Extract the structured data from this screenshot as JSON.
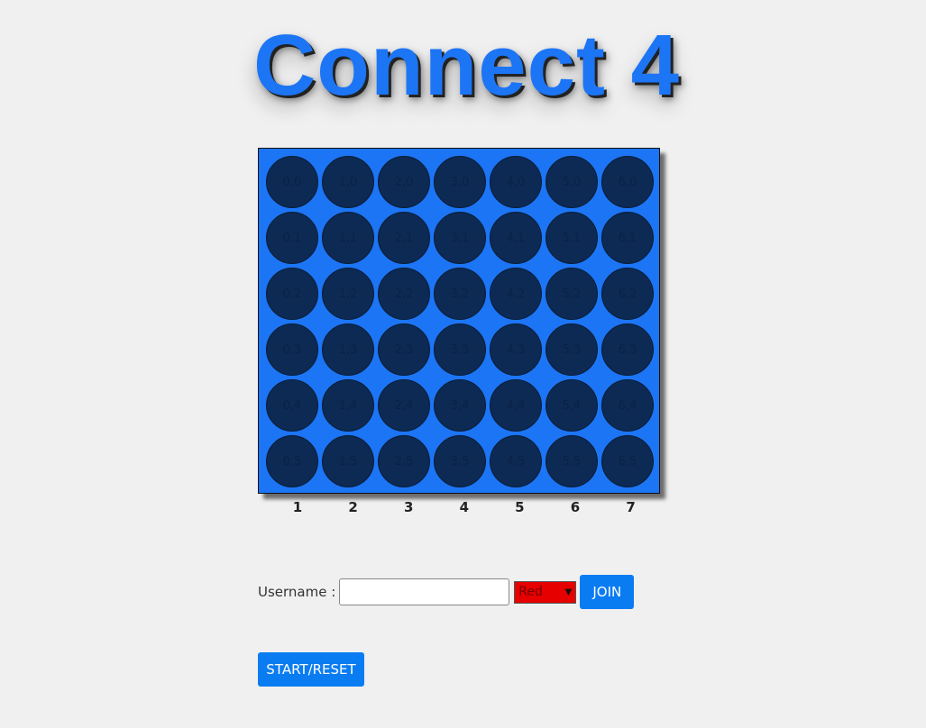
{
  "title": "Connect 4",
  "board": {
    "columns": 7,
    "rows": 6,
    "column_labels": [
      "1",
      "2",
      "3",
      "4",
      "5",
      "6",
      "7"
    ],
    "cells": [
      [
        "0,0",
        "1,0",
        "2,0",
        "3,0",
        "4,0",
        "5,0",
        "6,0"
      ],
      [
        "0,1",
        "1,1",
        "2,1",
        "3,1",
        "4,1",
        "5,1",
        "6,1"
      ],
      [
        "0,2",
        "1,2",
        "2,2",
        "3,2",
        "4,2",
        "5,2",
        "6,2"
      ],
      [
        "0,3",
        "1,3",
        "2,3",
        "3,3",
        "4,3",
        "5,3",
        "6,3"
      ],
      [
        "0,4",
        "1,4",
        "2,4",
        "3,4",
        "4,4",
        "5,4",
        "6,4"
      ],
      [
        "0,5",
        "1,5",
        "2,5",
        "3,5",
        "4,5",
        "5,5",
        "6,5"
      ]
    ],
    "board_color": "#1c75f5",
    "empty_cell_color": "#0c2a54"
  },
  "join": {
    "username_label": "Username :",
    "username_value": "",
    "color_selected": "Red",
    "color_select_bg": "#e60000",
    "join_label": "JOIN"
  },
  "controls": {
    "start_reset_label": "START/RESET"
  },
  "accent_color": "#0a7cf2"
}
